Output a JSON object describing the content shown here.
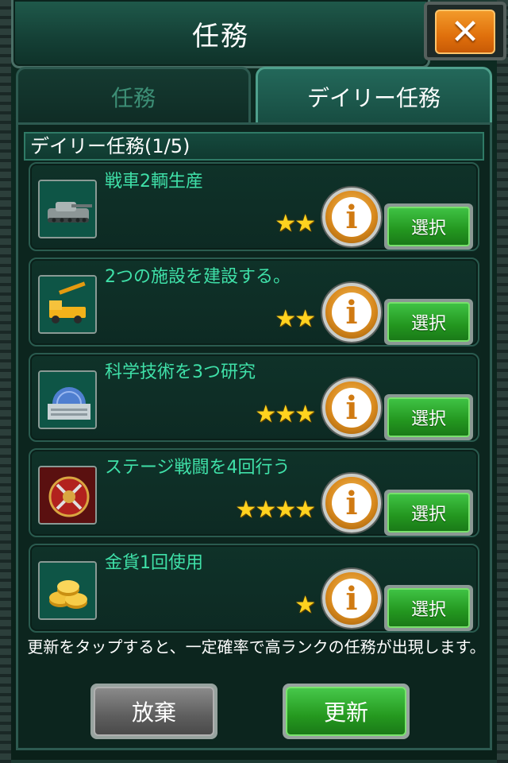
{
  "window": {
    "title": "任務",
    "close_symbol": "✕"
  },
  "tabs": [
    {
      "label": "任務",
      "active": false
    },
    {
      "label": "デイリー任務",
      "active": true
    }
  ],
  "section": {
    "header": "デイリー任務(1/5)"
  },
  "quests": [
    {
      "title": "戦車2輌生産",
      "stars": "★★",
      "rating": 2,
      "icon": "tank-icon",
      "select_label": "選択"
    },
    {
      "title": "2つの施設を建設する。",
      "stars": "★★",
      "rating": 2,
      "icon": "crane-truck-icon",
      "select_label": "選択"
    },
    {
      "title": "科学技術を3つ研究",
      "stars": "★★★",
      "rating": 3,
      "icon": "research-dome-icon",
      "select_label": "選択"
    },
    {
      "title": "ステージ戦闘を4回行う",
      "stars": "★★★★",
      "rating": 4,
      "icon": "battle-emblem-icon",
      "select_label": "選択"
    },
    {
      "title": "金貨1回使用",
      "stars": "★",
      "rating": 1,
      "icon": "gold-coins-icon",
      "select_label": "選択"
    }
  ],
  "info_glyph": "i",
  "notice": "更新をタップすると、一定確率で高ランクの任務が出現します。",
  "buttons": {
    "abandon": "放棄",
    "update": "更新"
  },
  "colors": {
    "accent_green": "#3fe0a8",
    "button_green": "#25991f",
    "close_orange": "#e0700c",
    "star_gold": "#ffd21f"
  }
}
